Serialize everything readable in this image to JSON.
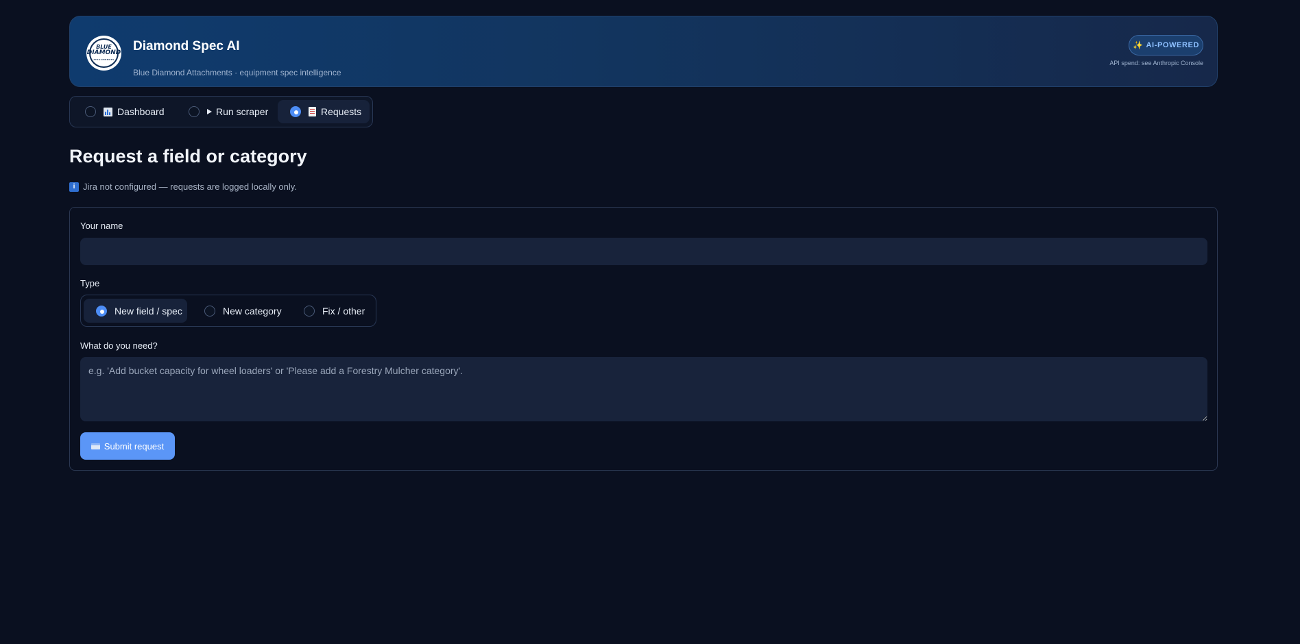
{
  "header": {
    "logo_text": [
      "BLUE",
      "DIAMOND",
      "ATTACHMENTS"
    ],
    "title": "Diamond Spec AI",
    "subtitle": "Blue Diamond Attachments · equipment spec intelligence",
    "badge": "AI-POWERED",
    "badge_icon": "sparkles-icon",
    "api_note": "API spend: see Anthropic Console"
  },
  "nav": {
    "items": [
      {
        "label": "Dashboard",
        "icon": "bar-chart-icon",
        "selected": false
      },
      {
        "label": "Run scraper",
        "icon": "play-icon",
        "selected": false
      },
      {
        "label": "Requests",
        "icon": "document-icon",
        "selected": true
      }
    ]
  },
  "page": {
    "title": "Request a field or category",
    "info": "Jira not configured — requests are logged locally only.",
    "info_icon": "info-icon"
  },
  "form": {
    "name_label": "Your name",
    "name_value": "",
    "type_label": "Type",
    "type_options": [
      {
        "label": "New field / spec",
        "selected": true
      },
      {
        "label": "New category",
        "selected": false
      },
      {
        "label": "Fix / other",
        "selected": false
      }
    ],
    "need_label": "What do you need?",
    "need_placeholder": "e.g. 'Add bucket capacity for wheel loaders' or 'Please add a Forestry Mulcher category'.",
    "need_value": "",
    "submit_label": "Submit request",
    "submit_icon": "envelope-icon"
  },
  "colors": {
    "background": "#0a1020",
    "accent": "#4d8df5",
    "button": "#5b96f7",
    "header_gradient_start": "#0f3b6e",
    "header_gradient_end": "#16284a"
  }
}
